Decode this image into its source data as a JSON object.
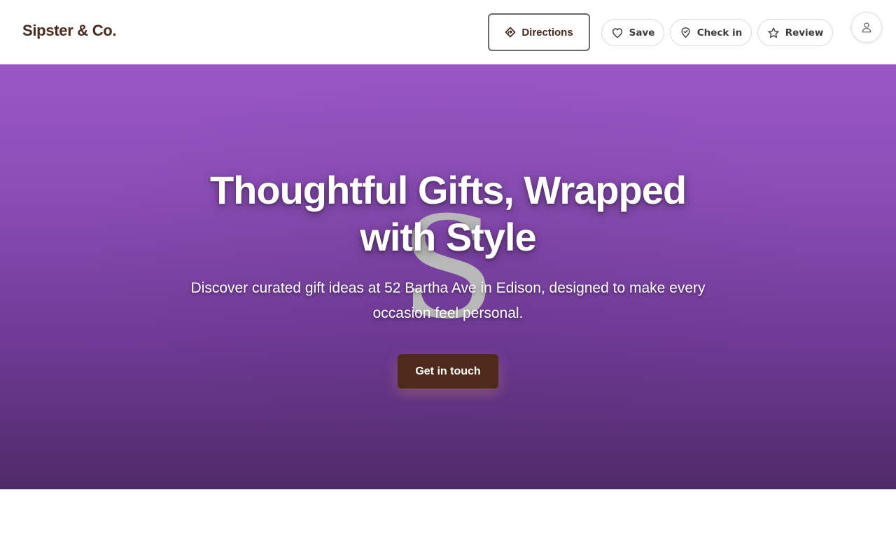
{
  "header": {
    "brand": "Sipster & Co.",
    "actions": {
      "directions": {
        "label": "Directions",
        "icon": "directions-icon"
      },
      "save": {
        "label": "Save",
        "icon": "heart-icon"
      },
      "check_in": {
        "label": "Check in",
        "icon": "map-pin-icon"
      },
      "review": {
        "label": "Review",
        "icon": "star-icon"
      }
    },
    "account_icon": "user-icon"
  },
  "hero": {
    "title": "Thoughtful Gifts, Wrapped with Style",
    "subtitle": "Discover curated gift ideas at 52 Bartha Ave in Edison, designed to make every occasion feel personal.",
    "cta_label": "Get in touch",
    "logo_letter": "S"
  },
  "colors": {
    "brand": "#4a2a1c",
    "hero_top": "#9957c6",
    "hero_bottom": "#4f2a68",
    "cta_background": "#4e2a1c"
  }
}
